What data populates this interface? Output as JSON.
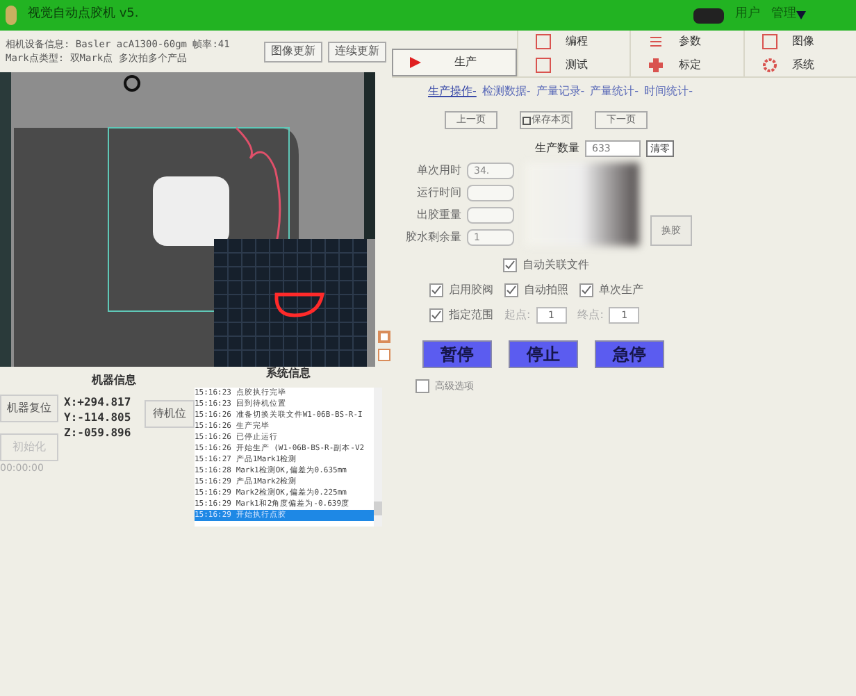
{
  "window": {
    "title": "视觉自动点胶机 v5."
  },
  "user": {
    "label": "用户",
    "name": "管理"
  },
  "camera_info": {
    "device": "相机设备信息: Basler acA1300-60gm 帧率:41",
    "mark_type": "Mark点类型: 双Mark点 多次拍多个产品",
    "buttons": [
      "图像更新",
      "连续更新"
    ]
  },
  "toolbar": [
    {
      "label": "生产",
      "selected": true,
      "kind": "big"
    },
    {
      "label": "编程",
      "selected": false,
      "kind": "small"
    },
    {
      "label": "测试",
      "selected": false,
      "kind": "small"
    },
    {
      "label": "参数",
      "selected": false,
      "kind": "small"
    },
    {
      "label": "标定",
      "selected": false,
      "kind": "small"
    },
    {
      "label": "图像",
      "selected": false,
      "kind": "small"
    },
    {
      "label": "系统",
      "selected": false,
      "kind": "small"
    }
  ],
  "machine_info": {
    "title": "机器信息",
    "coords": [
      "X:+294.817",
      "Y:-114.805",
      "Z:-059.896"
    ],
    "reset_button": "机器复位",
    "standby_button": "待机位",
    "init_button": {
      "label": "初始化",
      "disabled": true
    },
    "timer": "00:00:00"
  },
  "system_info": {
    "title": "系统信息",
    "log": [
      {
        "time": "15:16:23",
        "text": "点胶执行完毕",
        "selected": false
      },
      {
        "time": "15:16:23",
        "text": "回到待机位置",
        "selected": false
      },
      {
        "time": "15:16:26",
        "text": "准备切换关联文件W1-06B-BS-R-I",
        "selected": false
      },
      {
        "time": "15:16:26",
        "text": "生产完毕",
        "selected": false
      },
      {
        "time": "15:16:26",
        "text": "已停止运行",
        "selected": false
      },
      {
        "time": "15:16:26",
        "text": "开始生产 (W1-06B-BS-R-副本-V2",
        "selected": false
      },
      {
        "time": "15:16:27",
        "text": "产品1Mark1检测",
        "selected": false
      },
      {
        "time": "15:16:28",
        "text": "Mark1检测OK,偏差为0.635mm",
        "selected": false
      },
      {
        "time": "15:16:29",
        "text": "产品1Mark2检测",
        "selected": false
      },
      {
        "time": "15:16:29",
        "text": "Mark2检测OK,偏差为0.225mm",
        "selected": false
      },
      {
        "time": "15:16:29",
        "text": "Mark1和2角度偏差为-0.639度",
        "selected": false
      },
      {
        "time": "15:16:29",
        "text": "开始执行点胶",
        "selected": true
      }
    ]
  },
  "breadcrumb": [
    {
      "label": "生产操作-",
      "selected": true
    },
    {
      "label": "检测数据-",
      "selected": false
    },
    {
      "label": "产量记录-",
      "selected": false
    },
    {
      "label": "产量统计-",
      "selected": false
    },
    {
      "label": "时间统计-",
      "selected": false
    }
  ],
  "page_buttons": [
    "上一页",
    "保存本页",
    "下一页"
  ],
  "production_count": {
    "label": "生产数量",
    "value": "633",
    "button": "清零"
  },
  "stats": [
    {
      "label": "单次用时",
      "value": "34."
    },
    {
      "label": "运行时间"
    },
    {
      "label": "出胶重量"
    },
    {
      "label": "胶水剩余量",
      "value": "1"
    }
  ],
  "change_glue_button": "换胶",
  "options": {
    "auto_link": {
      "label": "自动关联文件",
      "checked": true
    },
    "row": [
      {
        "label": "启用胶阀",
        "checked": true
      },
      {
        "label": "自动拍照",
        "checked": true
      },
      {
        "label": "单次生产",
        "checked": true
      }
    ],
    "range": {
      "label": "指定范围",
      "checked": true,
      "start_label": "起点:",
      "start": "1",
      "end_label": "终点:",
      "end": "1"
    }
  },
  "control_buttons": [
    "暂停",
    "停止",
    "急停"
  ],
  "advanced": {
    "label": "高级选项",
    "checked": false
  }
}
